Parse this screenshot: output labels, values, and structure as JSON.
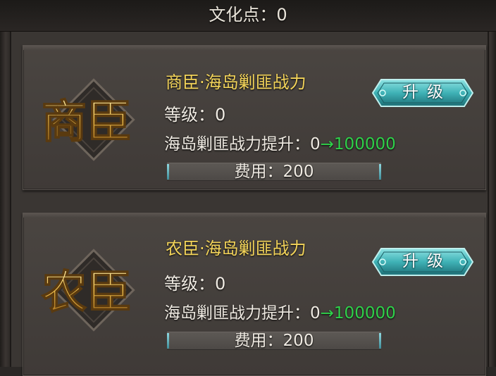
{
  "header": {
    "culture_points": "文化点：0"
  },
  "cards": [
    {
      "emblem": "商臣",
      "title": "商臣·海岛剿匪战力",
      "level": "等级：0",
      "boost_prefix": "海岛剿匪战力提升：0",
      "boost_arrow": "→",
      "boost_value": "100000",
      "cost": "费用：200",
      "button": "升级"
    },
    {
      "emblem": "农臣",
      "title": "农臣·海岛剿匪战力",
      "level": "等级：0",
      "boost_prefix": "海岛剿匪战力提升：0",
      "boost_arrow": "→",
      "boost_value": "100000",
      "cost": "费用：200",
      "button": "升级"
    }
  ],
  "colors": {
    "title_gold": "#f3d45a",
    "boost_green": "#2fd14a",
    "button_teal": "#3fb2b6"
  }
}
